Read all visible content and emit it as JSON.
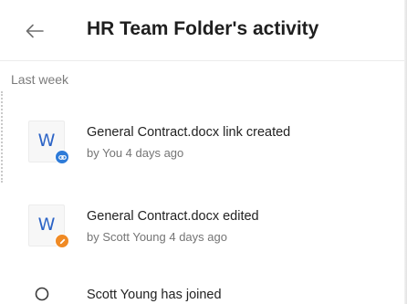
{
  "header": {
    "title": "HR Team Folder's activity",
    "back_icon": "arrow-left-icon"
  },
  "section": {
    "label": "Last week"
  },
  "activities": [
    {
      "title": "General Contract.docx link created",
      "subtitle": "by You 4 days ago",
      "file_letter": "W",
      "badge_icon": "link-icon",
      "badge_color": "#2e7bd8"
    },
    {
      "title": "General Contract.docx edited",
      "subtitle": "by Scott Young 4 days ago",
      "file_letter": "W",
      "badge_icon": "pencil-icon",
      "badge_color": "#f08a24"
    },
    {
      "title": "Scott Young has joined",
      "icon": "person-icon"
    }
  ],
  "colors": {
    "word_blue": "#2b63c6",
    "text_primary": "#222222",
    "text_secondary": "#757575"
  }
}
